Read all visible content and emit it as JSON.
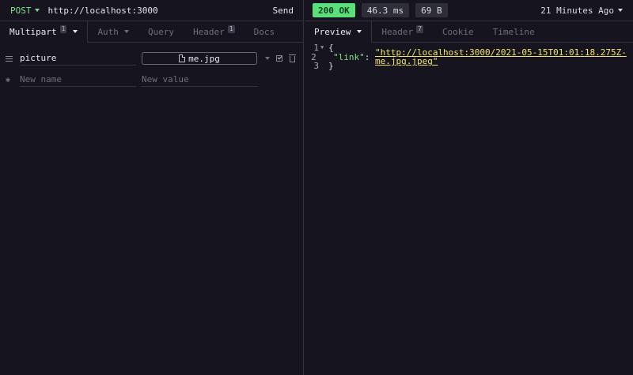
{
  "request": {
    "method": "POST",
    "url": "http://localhost:3000",
    "send_label": "Send",
    "tabs": [
      {
        "label": "Multipart",
        "badge": "1"
      },
      {
        "label": "Auth"
      },
      {
        "label": "Query"
      },
      {
        "label": "Header",
        "badge": "1"
      },
      {
        "label": "Docs"
      }
    ],
    "params": [
      {
        "name": "picture",
        "file": "me.jpg"
      }
    ],
    "new_name_placeholder": "New name",
    "new_value_placeholder": "New value"
  },
  "response": {
    "status": "200 OK",
    "time": "46.3 ms",
    "size": "69 B",
    "ago": "21 Minutes Ago",
    "tabs": [
      {
        "label": "Preview"
      },
      {
        "label": "Header",
        "badge": "7"
      },
      {
        "label": "Cookie"
      },
      {
        "label": "Timeline"
      }
    ],
    "body": {
      "line1": "{",
      "key": "\"link\"",
      "colon": ": ",
      "value": "\"http://localhost:3000/2021-05-15T01:01:18.275Z-me.jpg.jpeg\"",
      "line3": "}",
      "line_numbers": [
        "1",
        "2",
        "3"
      ]
    }
  },
  "colors": {
    "status_ok": "#59e07b",
    "method": "#7fe08a",
    "link": "#f2e46a"
  },
  "icons": [
    "chevron-down-icon",
    "drag-handle-icon",
    "file-icon",
    "checkbox-icon",
    "trash-icon",
    "gear-icon",
    "fold-arrow-icon"
  ]
}
